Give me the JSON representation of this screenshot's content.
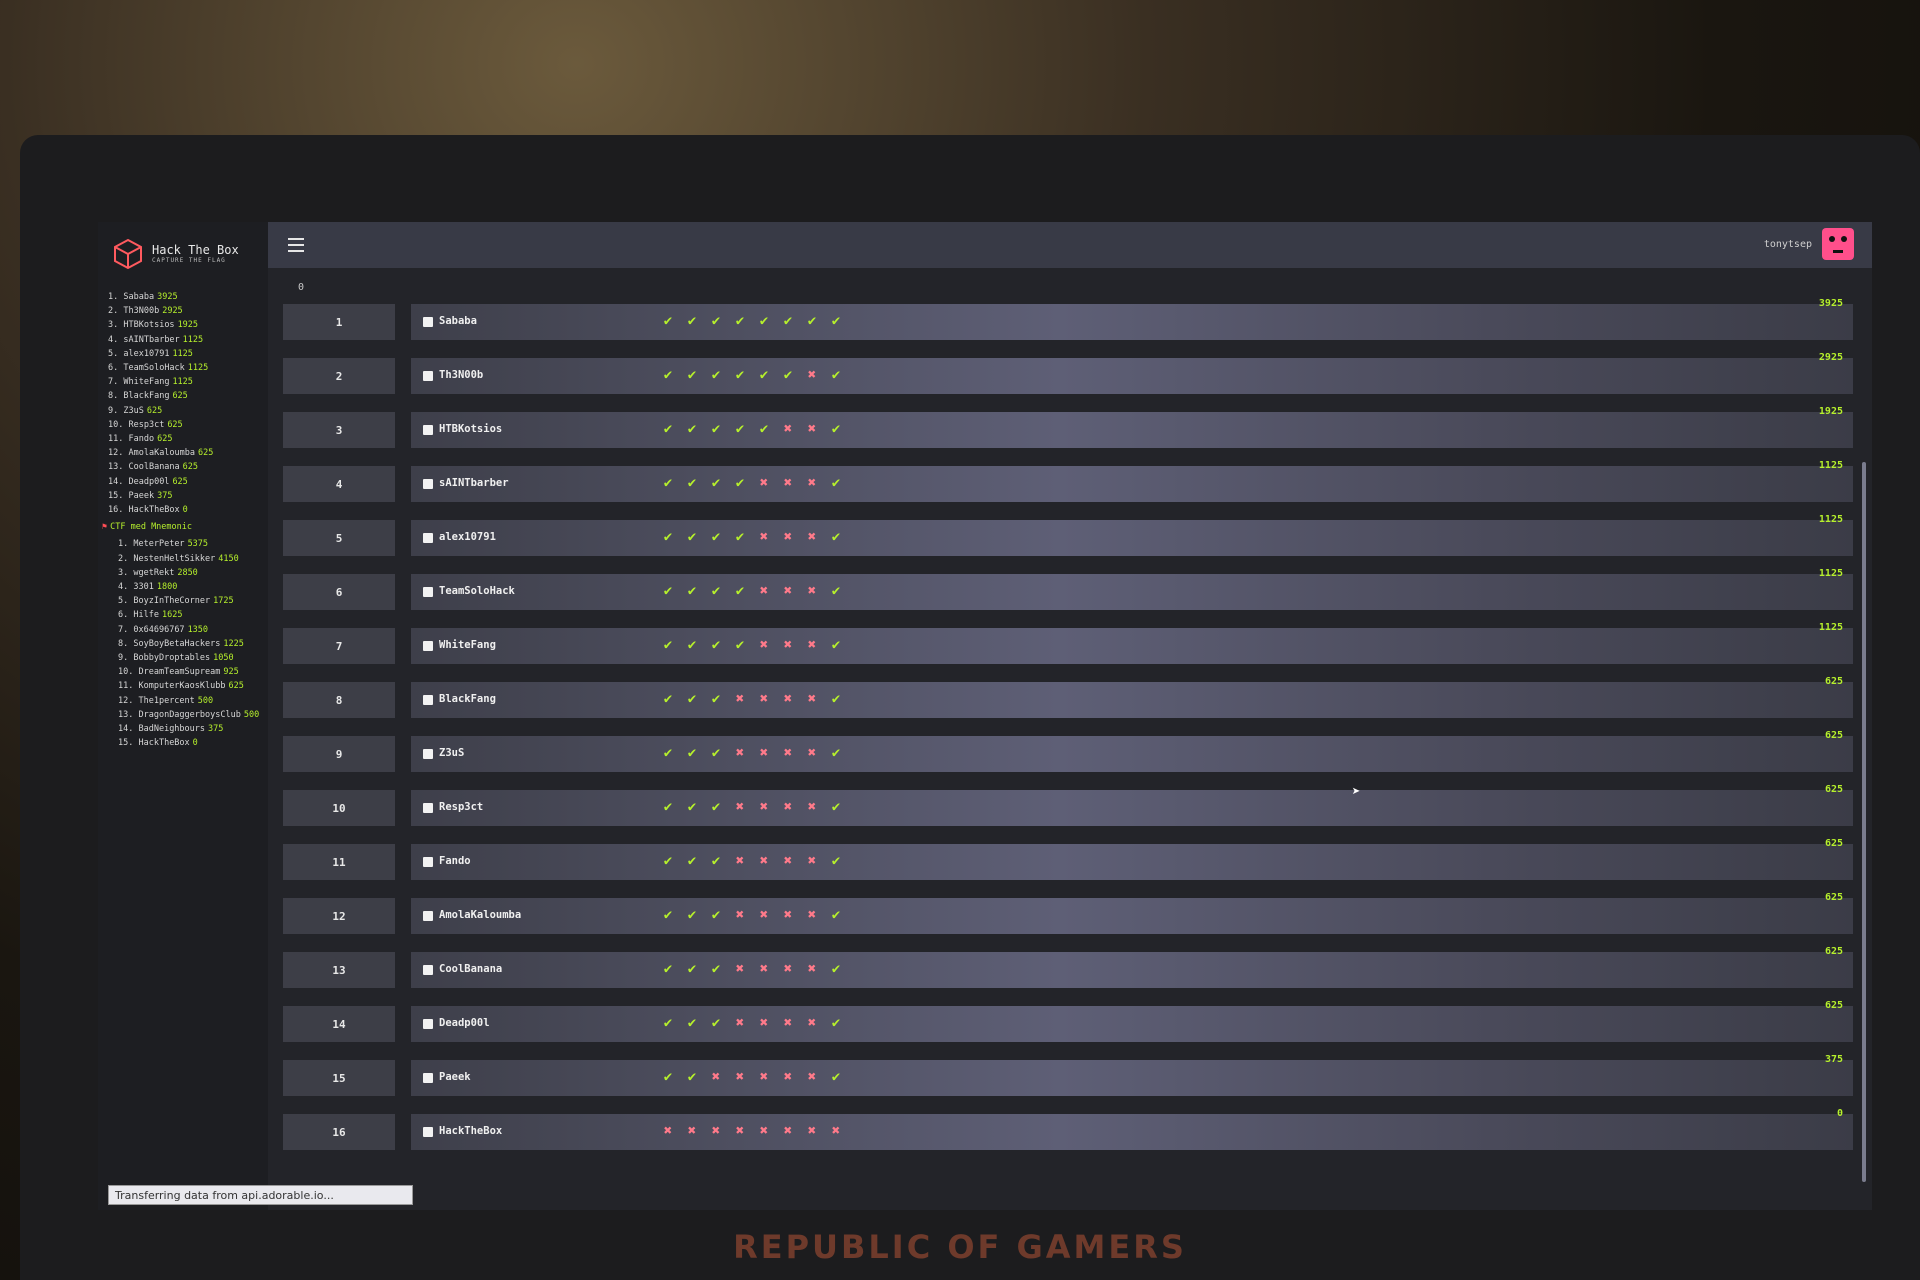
{
  "brand": {
    "name": "Hack The Box",
    "tagline": "CAPTURE THE FLAG"
  },
  "user": {
    "name": "tonytsep"
  },
  "axis": {
    "zero": "0"
  },
  "device_brand": "REPUBLIC OF GAMERS",
  "status_text": "Transferring data from api.adorable.io...",
  "sidebar": {
    "leaderboard": [
      {
        "rank": "1.",
        "name": "Sababa",
        "score": "3925"
      },
      {
        "rank": "2.",
        "name": "Th3N00b",
        "score": "2925"
      },
      {
        "rank": "3.",
        "name": "HTBKotsios",
        "score": "1925"
      },
      {
        "rank": "4.",
        "name": "sAINTbarber",
        "score": "1125"
      },
      {
        "rank": "5.",
        "name": "alex10791",
        "score": "1125"
      },
      {
        "rank": "6.",
        "name": "TeamSoloHack",
        "score": "1125"
      },
      {
        "rank": "7.",
        "name": "WhiteFang",
        "score": "1125"
      },
      {
        "rank": "8.",
        "name": "BlackFang",
        "score": "625"
      },
      {
        "rank": "9.",
        "name": "Z3uS",
        "score": "625"
      },
      {
        "rank": "10.",
        "name": "Resp3ct",
        "score": "625"
      },
      {
        "rank": "11.",
        "name": "Fando",
        "score": "625"
      },
      {
        "rank": "12.",
        "name": "AmolaKaloumba",
        "score": "625"
      },
      {
        "rank": "13.",
        "name": "CoolBanana",
        "score": "625"
      },
      {
        "rank": "14.",
        "name": "Deadp00l",
        "score": "625"
      },
      {
        "rank": "15.",
        "name": "Paeek",
        "score": "375"
      },
      {
        "rank": "16.",
        "name": "HackTheBox",
        "score": "0"
      }
    ],
    "ctf_label": "CTF med Mnemonic",
    "ctf_board": [
      {
        "rank": "1.",
        "name": "MeterPeter",
        "score": "5375"
      },
      {
        "rank": "2.",
        "name": "NestenHeltSikker",
        "score": "4150"
      },
      {
        "rank": "3.",
        "name": "wgetRekt",
        "score": "2850"
      },
      {
        "rank": "4.",
        "name": "3301",
        "score": "1800"
      },
      {
        "rank": "5.",
        "name": "BoyzInTheCorner",
        "score": "1725"
      },
      {
        "rank": "6.",
        "name": "Hilfe",
        "score": "1625"
      },
      {
        "rank": "7.",
        "name": "0x64696767",
        "score": "1350"
      },
      {
        "rank": "8.",
        "name": "SoyBoyBetaHackers",
        "score": "1225"
      },
      {
        "rank": "9.",
        "name": "BobbyDroptables",
        "score": "1050"
      },
      {
        "rank": "10.",
        "name": "DreamTeamSupream",
        "score": "925"
      },
      {
        "rank": "11.",
        "name": "KomputerKaosKlubb",
        "score": "625"
      },
      {
        "rank": "12.",
        "name": "The1percent",
        "score": "500"
      },
      {
        "rank": "13.",
        "name": "DragonDaggerboysClub",
        "score": "500"
      },
      {
        "rank": "14.",
        "name": "BadNeighbours",
        "score": "375"
      },
      {
        "rank": "15.",
        "name": "HackTheBox",
        "score": "0"
      }
    ]
  },
  "rows": [
    {
      "rank": "1",
      "team": "Sababa",
      "score": "3925",
      "marks": [
        1,
        1,
        1,
        1,
        1,
        1,
        1,
        1
      ]
    },
    {
      "rank": "2",
      "team": "Th3N00b",
      "score": "2925",
      "marks": [
        1,
        1,
        1,
        1,
        1,
        1,
        0,
        1
      ]
    },
    {
      "rank": "3",
      "team": "HTBKotsios",
      "score": "1925",
      "marks": [
        1,
        1,
        1,
        1,
        1,
        0,
        0,
        1
      ]
    },
    {
      "rank": "4",
      "team": "sAINTbarber",
      "score": "1125",
      "marks": [
        1,
        1,
        1,
        1,
        0,
        0,
        0,
        1
      ]
    },
    {
      "rank": "5",
      "team": "alex10791",
      "score": "1125",
      "marks": [
        1,
        1,
        1,
        1,
        0,
        0,
        0,
        1
      ]
    },
    {
      "rank": "6",
      "team": "TeamSoloHack",
      "score": "1125",
      "marks": [
        1,
        1,
        1,
        1,
        0,
        0,
        0,
        1
      ]
    },
    {
      "rank": "7",
      "team": "WhiteFang",
      "score": "1125",
      "marks": [
        1,
        1,
        1,
        1,
        0,
        0,
        0,
        1
      ]
    },
    {
      "rank": "8",
      "team": "BlackFang",
      "score": "625",
      "marks": [
        1,
        1,
        1,
        0,
        0,
        0,
        0,
        1
      ]
    },
    {
      "rank": "9",
      "team": "Z3uS",
      "score": "625",
      "marks": [
        1,
        1,
        1,
        0,
        0,
        0,
        0,
        1
      ]
    },
    {
      "rank": "10",
      "team": "Resp3ct",
      "score": "625",
      "marks": [
        1,
        1,
        1,
        0,
        0,
        0,
        0,
        1
      ]
    },
    {
      "rank": "11",
      "team": "Fando",
      "score": "625",
      "marks": [
        1,
        1,
        1,
        0,
        0,
        0,
        0,
        1
      ]
    },
    {
      "rank": "12",
      "team": "AmolaKaloumba",
      "score": "625",
      "marks": [
        1,
        1,
        1,
        0,
        0,
        0,
        0,
        1
      ]
    },
    {
      "rank": "13",
      "team": "CoolBanana",
      "score": "625",
      "marks": [
        1,
        1,
        1,
        0,
        0,
        0,
        0,
        1
      ]
    },
    {
      "rank": "14",
      "team": "Deadp00l",
      "score": "625",
      "marks": [
        1,
        1,
        1,
        0,
        0,
        0,
        0,
        1
      ]
    },
    {
      "rank": "15",
      "team": "Paeek",
      "score": "375",
      "marks": [
        1,
        1,
        0,
        0,
        0,
        0,
        0,
        1
      ]
    },
    {
      "rank": "16",
      "team": "HackTheBox",
      "score": "0",
      "marks": [
        0,
        0,
        0,
        0,
        0,
        0,
        0,
        0
      ]
    }
  ],
  "icons": {
    "check": "check-icon",
    "cross": "cross-icon"
  },
  "colors": {
    "accent": "#b6f02c",
    "fail": "#ff7a8a",
    "avatar": "#ff4f8b"
  }
}
